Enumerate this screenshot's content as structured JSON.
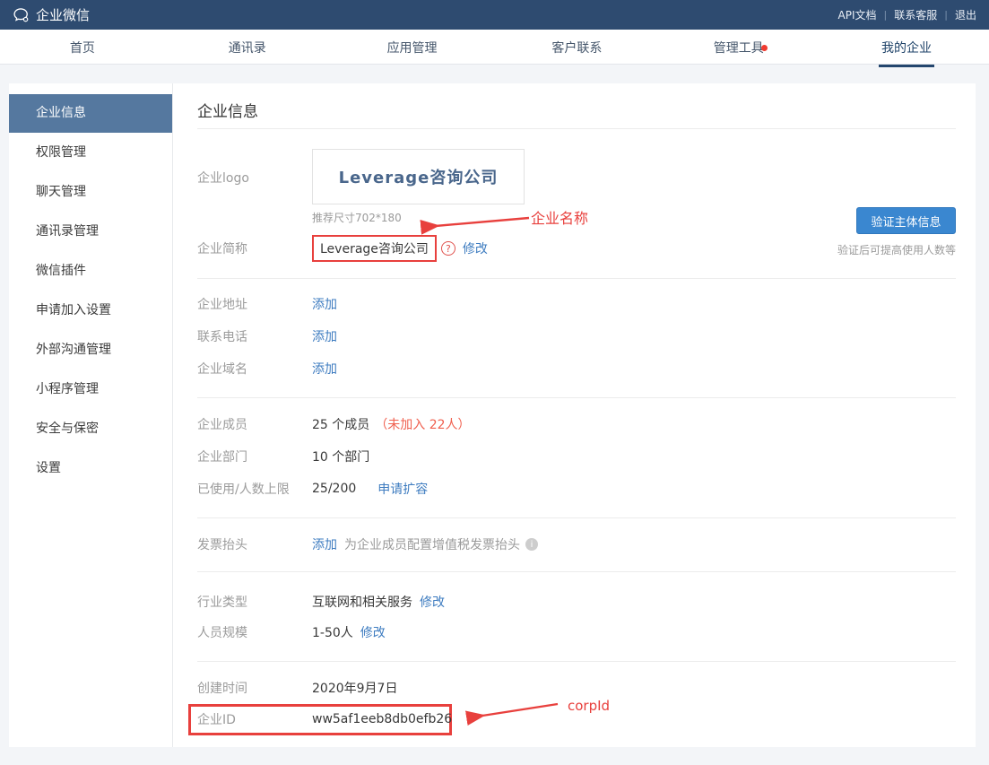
{
  "topbar": {
    "brand": "企业微信",
    "separator": "|",
    "links": [
      {
        "label": "API文档"
      },
      {
        "label": "联系客服"
      },
      {
        "label": "退出"
      }
    ]
  },
  "nav": {
    "items": [
      {
        "label": "首页",
        "active": false
      },
      {
        "label": "通讯录",
        "active": false
      },
      {
        "label": "应用管理",
        "active": false
      },
      {
        "label": "客户联系",
        "active": false
      },
      {
        "label": "管理工具",
        "active": false,
        "badge_dot": true
      },
      {
        "label": "我的企业",
        "active": true
      }
    ]
  },
  "sidebar": {
    "items": [
      {
        "label": "企业信息",
        "active": true
      },
      {
        "label": "权限管理",
        "active": false
      },
      {
        "label": "聊天管理",
        "active": false
      },
      {
        "label": "通讯录管理",
        "active": false
      },
      {
        "label": "微信插件",
        "active": false
      },
      {
        "label": "申请加入设置",
        "active": false
      },
      {
        "label": "外部沟通管理",
        "active": false
      },
      {
        "label": "小程序管理",
        "active": false
      },
      {
        "label": "安全与保密",
        "active": false
      },
      {
        "label": "设置",
        "active": false
      }
    ]
  },
  "main": {
    "title": "企业信息",
    "logo": {
      "label": "企业logo",
      "text": "Leverage咨询公司",
      "hint": "推荐尺寸702*180"
    },
    "verify": {
      "button": "验证主体信息",
      "hint": "验证后可提高使用人数等"
    },
    "shortname": {
      "label": "企业简称",
      "value": "Leverage咨询公司",
      "help_icon": "?",
      "modify": "修改"
    },
    "address": {
      "label": "企业地址",
      "add": "添加"
    },
    "phone": {
      "label": "联系电话",
      "add": "添加"
    },
    "domain": {
      "label": "企业域名",
      "add": "添加"
    },
    "members": {
      "label": "企业成员",
      "value": "25 个成员",
      "extra": "（未加入 22人）"
    },
    "departments": {
      "label": "企业部门",
      "value": "10 个部门"
    },
    "usage": {
      "label": "已使用/人数上限",
      "value": "25/200",
      "link": "申请扩容"
    },
    "invoice": {
      "label": "发票抬头",
      "add": "添加",
      "desc": "为企业成员配置增值税发票抬头",
      "info_icon": "i"
    },
    "industry": {
      "label": "行业类型",
      "value": "互联网和相关服务",
      "modify": "修改"
    },
    "scale": {
      "label": "人员规模",
      "value": "1-50人",
      "modify": "修改"
    },
    "created": {
      "label": "创建时间",
      "value": "2020年9月7日"
    },
    "corpid": {
      "label": "企业ID",
      "value": "ww5af1eeb8db0efb26"
    }
  },
  "annotations": {
    "name_label": "企业名称",
    "corpid_label": "corpId"
  },
  "colors": {
    "topbar_bg": "#2e4b70",
    "nav_active": "#24466e",
    "sidebar_active_bg": "#55789f",
    "button_blue": "#3a87d0",
    "link_blue": "#3e7cc0",
    "annotation_red": "#e8403d",
    "warning_red": "#f0604f"
  }
}
